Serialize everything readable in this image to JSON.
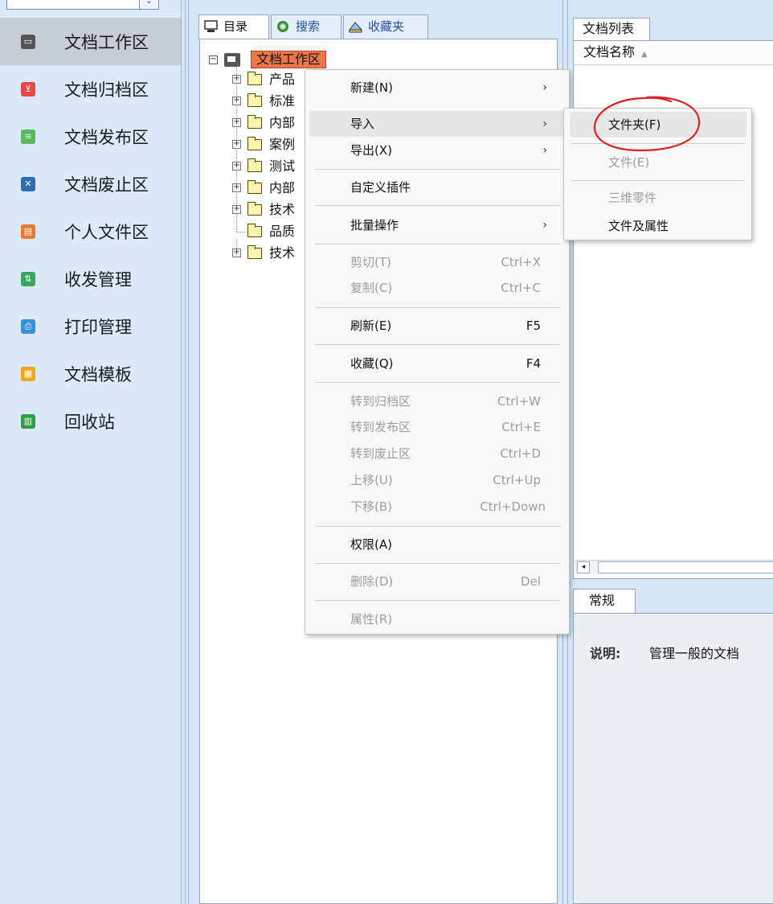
{
  "sidebar": {
    "items": [
      {
        "label": "文档工作区",
        "icon": "monitor-icon",
        "color": "#555555"
      },
      {
        "label": "文档归档区",
        "icon": "archive-icon",
        "color": "#e84747"
      },
      {
        "label": "文档发布区",
        "icon": "publish-icon",
        "color": "#5cb85c"
      },
      {
        "label": "文档废止区",
        "icon": "abolish-icon",
        "color": "#2d6db5"
      },
      {
        "label": "个人文件区",
        "icon": "personal-icon",
        "color": "#e8792d"
      },
      {
        "label": "收发管理",
        "icon": "mail-icon",
        "color": "#3aa85a"
      },
      {
        "label": "打印管理",
        "icon": "printer-icon",
        "color": "#3b8fd8"
      },
      {
        "label": "文档模板",
        "icon": "template-icon",
        "color": "#f0a818"
      },
      {
        "label": "回收站",
        "icon": "trash-icon",
        "color": "#2f9c4a"
      }
    ]
  },
  "tree_tabs": [
    {
      "label": "目录",
      "icon": "directory-icon"
    },
    {
      "label": "搜索",
      "icon": "search-icon"
    },
    {
      "label": "收藏夹",
      "icon": "favorites-icon"
    }
  ],
  "tree": {
    "root": "文档工作区",
    "nodes": [
      "产品",
      "标准",
      "内部",
      "案例",
      "测试",
      "内部",
      "技术",
      "品质",
      "技术"
    ]
  },
  "doc_list": {
    "tab": "文档列表",
    "column": "文档名称"
  },
  "props": {
    "tab": "常规",
    "desc_label": "说明:",
    "desc_value": "管理一般的文档"
  },
  "context_menu": {
    "items": [
      {
        "label": "新建(N)",
        "arrow": true
      },
      {
        "label": "导入",
        "arrow": true,
        "highlighted": true
      },
      {
        "label": "导出(X)",
        "arrow": true
      },
      {
        "label": "自定义插件"
      },
      {
        "label": "批量操作",
        "arrow": true
      },
      {
        "label": "剪切(T)",
        "shortcut": "Ctrl+X",
        "disabled": true
      },
      {
        "label": "复制(C)",
        "shortcut": "Ctrl+C",
        "disabled": true
      },
      {
        "label": "刷新(E)",
        "shortcut": "F5"
      },
      {
        "label": "收藏(Q)",
        "shortcut": "F4"
      },
      {
        "label": "转到归档区",
        "shortcut": "Ctrl+W",
        "disabled": true
      },
      {
        "label": "转到发布区",
        "shortcut": "Ctrl+E",
        "disabled": true
      },
      {
        "label": "转到废止区",
        "shortcut": "Ctrl+D",
        "disabled": true
      },
      {
        "label": "上移(U)",
        "shortcut": "Ctrl+Up",
        "disabled": true
      },
      {
        "label": "下移(B)",
        "shortcut": "Ctrl+Down",
        "disabled": true
      },
      {
        "label": "权限(A)"
      },
      {
        "label": "删除(D)",
        "shortcut": "Del",
        "disabled": true
      },
      {
        "label": "属性(R)",
        "disabled": true
      }
    ],
    "arrow_glyph": "›"
  },
  "submenu": {
    "items": [
      {
        "label": "文件夹(F)",
        "highlighted": true
      },
      {
        "label": "文件(E)",
        "disabled": true
      },
      {
        "label": "三维零件",
        "disabled": true
      },
      {
        "label": "文件及属性"
      }
    ]
  },
  "annotation": {
    "color": "#e02020"
  }
}
